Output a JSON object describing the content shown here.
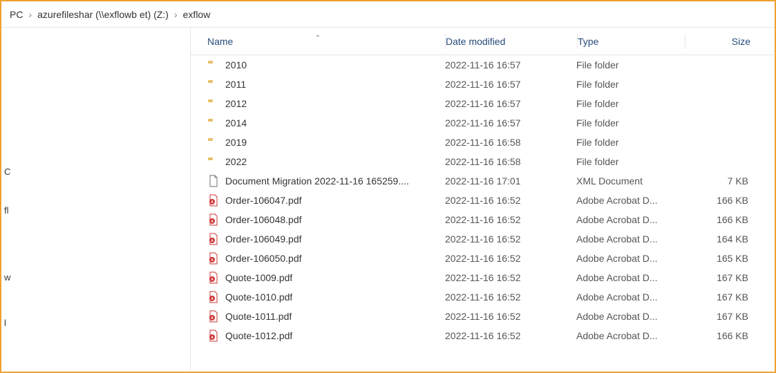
{
  "breadcrumb": {
    "items": [
      "PC",
      "azurefileshar   (\\\\exflowb              et) (Z:)",
      "exflow"
    ]
  },
  "nav": {
    "items": [
      "C",
      "fl",
      "w",
      "l"
    ]
  },
  "columns": {
    "name": "Name",
    "date": "Date modified",
    "type": "Type",
    "size": "Size",
    "sorted": "name",
    "direction": "asc"
  },
  "rows": [
    {
      "icon": "folder",
      "name": "2010",
      "date": "2022-11-16 16:57",
      "type": "File folder",
      "size": ""
    },
    {
      "icon": "folder",
      "name": "2011",
      "date": "2022-11-16 16:57",
      "type": "File folder",
      "size": ""
    },
    {
      "icon": "folder",
      "name": "2012",
      "date": "2022-11-16 16:57",
      "type": "File folder",
      "size": ""
    },
    {
      "icon": "folder",
      "name": "2014",
      "date": "2022-11-16 16:57",
      "type": "File folder",
      "size": ""
    },
    {
      "icon": "folder",
      "name": "2019",
      "date": "2022-11-16 16:58",
      "type": "File folder",
      "size": ""
    },
    {
      "icon": "folder",
      "name": "2022",
      "date": "2022-11-16 16:58",
      "type": "File folder",
      "size": ""
    },
    {
      "icon": "xml",
      "name": "Document Migration 2022-11-16 165259....",
      "date": "2022-11-16 17:01",
      "type": "XML Document",
      "size": "7 KB"
    },
    {
      "icon": "pdf",
      "name": "Order-106047.pdf",
      "date": "2022-11-16 16:52",
      "type": "Adobe Acrobat D...",
      "size": "166 KB"
    },
    {
      "icon": "pdf",
      "name": "Order-106048.pdf",
      "date": "2022-11-16 16:52",
      "type": "Adobe Acrobat D...",
      "size": "166 KB"
    },
    {
      "icon": "pdf",
      "name": "Order-106049.pdf",
      "date": "2022-11-16 16:52",
      "type": "Adobe Acrobat D...",
      "size": "164 KB"
    },
    {
      "icon": "pdf",
      "name": "Order-106050.pdf",
      "date": "2022-11-16 16:52",
      "type": "Adobe Acrobat D...",
      "size": "165 KB"
    },
    {
      "icon": "pdf",
      "name": "Quote-1009.pdf",
      "date": "2022-11-16 16:52",
      "type": "Adobe Acrobat D...",
      "size": "167 KB"
    },
    {
      "icon": "pdf",
      "name": "Quote-1010.pdf",
      "date": "2022-11-16 16:52",
      "type": "Adobe Acrobat D...",
      "size": "167 KB"
    },
    {
      "icon": "pdf",
      "name": "Quote-1011.pdf",
      "date": "2022-11-16 16:52",
      "type": "Adobe Acrobat D...",
      "size": "167 KB"
    },
    {
      "icon": "pdf",
      "name": "Quote-1012.pdf",
      "date": "2022-11-16 16:52",
      "type": "Adobe Acrobat D...",
      "size": "166 KB"
    }
  ]
}
